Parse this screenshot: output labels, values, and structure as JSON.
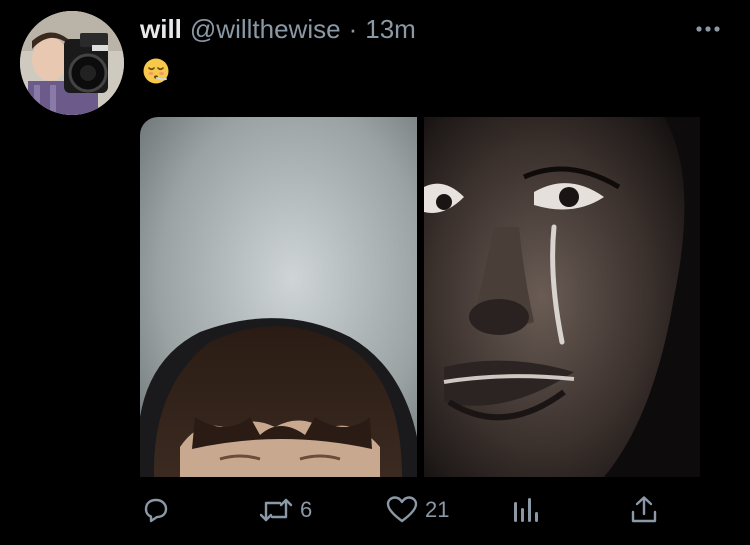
{
  "tweet": {
    "display_name": "will",
    "handle": "@willthewise",
    "separator": "·",
    "time": "13m",
    "text": "😮‍💨"
  },
  "actions": {
    "retweet_count": "6",
    "like_count": "21"
  },
  "colors": {
    "background": "#000000",
    "primary_text": "#e7e9ea",
    "secondary_text": "#8b98a5"
  },
  "icons": [
    "more-icon",
    "reply-icon",
    "retweet-icon",
    "like-icon",
    "analytics-icon",
    "share-icon"
  ]
}
